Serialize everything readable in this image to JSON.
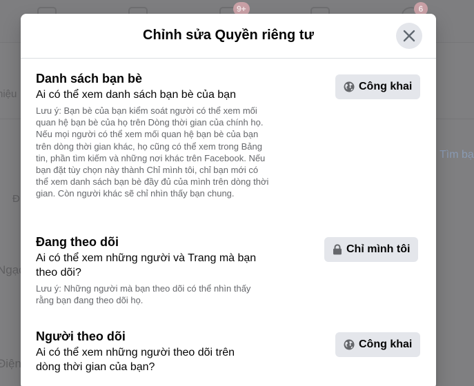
{
  "background": {
    "badges": [
      "9+",
      "6"
    ],
    "left_fragments": [
      "hiệu",
      "Đ",
      "Ngạc",
      "Điện"
    ],
    "right_link": "Tìm bạ"
  },
  "modal": {
    "title": "Chỉnh sửa Quyền riêng tư",
    "sections": [
      {
        "title": "Danh sách bạn bè",
        "question": "Ai có thể xem danh sách bạn bè của bạn",
        "note": "Lưu ý: Bạn bè của bạn kiểm soát người có thể xem mối quan hệ bạn bè của họ trên Dòng thời gian của chính họ. Nếu mọi người có thể xem mối quan hệ bạn bè của bạn trên dòng thời gian khác, họ cũng có thể xem trong Bảng tin, phần tìm kiếm và những nơi khác trên Facebook. Nếu bạn đặt tùy chọn này thành Chỉ mình tôi, chỉ bạn mới có thể xem danh sách bạn bè đầy đủ của mình trên dòng thời gian. Còn người khác sẽ chỉ nhìn thấy bạn chung.",
        "audience": "Công khai",
        "audience_icon": "globe-icon"
      },
      {
        "title": "Đang theo dõi",
        "question": "Ai có thể xem những người và Trang mà bạn theo dõi?",
        "note": "Lưu ý: Những người mà bạn theo dõi có thể nhìn thấy rằng bạn đang theo dõi họ.",
        "audience": "Chỉ mình tôi",
        "audience_icon": "lock-icon"
      },
      {
        "title": "Người theo dõi",
        "question": "Ai có thể xem những người theo dõi trên dòng thời gian của bạn?",
        "note": "",
        "audience": "Công khai",
        "audience_icon": "globe-icon"
      }
    ]
  }
}
